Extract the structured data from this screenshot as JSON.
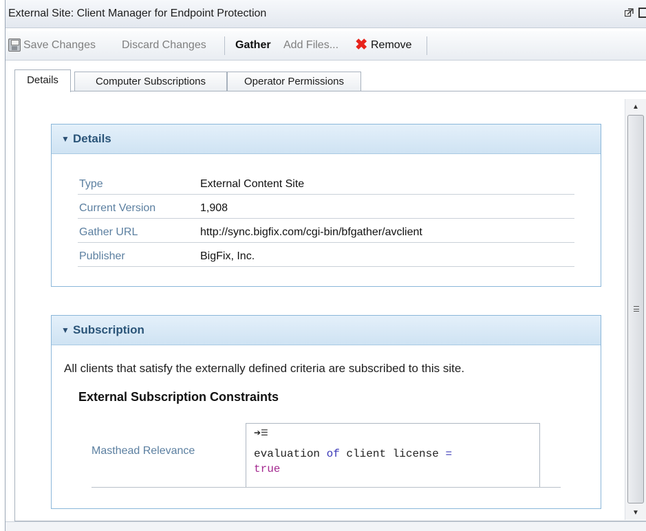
{
  "window": {
    "title": "External Site: Client Manager for Endpoint Protection"
  },
  "toolbar": {
    "save_label": "Save Changes",
    "discard_label": "Discard Changes",
    "gather_label": "Gather",
    "add_files_label": "Add Files...",
    "remove_label": "Remove"
  },
  "tabs": [
    {
      "label": "Details",
      "active": true
    },
    {
      "label": "Computer Subscriptions",
      "active": false
    },
    {
      "label": "Operator Permissions",
      "active": false
    }
  ],
  "details": {
    "header": "Details",
    "rows": [
      {
        "label": "Type",
        "value": "External Content Site"
      },
      {
        "label": "Current Version",
        "value": "1,908"
      },
      {
        "label": "Gather URL",
        "value": "http://sync.bigfix.com/cgi-bin/bfgather/avclient"
      },
      {
        "label": "Publisher",
        "value": "BigFix, Inc."
      }
    ]
  },
  "subscription": {
    "header": "Subscription",
    "text": "All clients that satisfy the externally defined criteria are subscribed to this site.",
    "constraints_heading": "External Subscription Constraints",
    "masthead_label": "Masthead Relevance",
    "relevance": {
      "part1": "evaluation ",
      "keyword": "of",
      "part2": " client license ",
      "operator": "=",
      "value": "true"
    }
  },
  "icons": {
    "save": "save-icon",
    "remove": "remove-icon",
    "restore": "restore-window-icon",
    "maximize": "maximize-icon",
    "caret": "caret-down-icon",
    "relevance_toggle": "relevance-format-icon"
  },
  "colors": {
    "panel_border": "#8ab6d9",
    "label_blue": "#5b7fa0",
    "remove_red": "#e8231b",
    "keyword_blue": "#3a38b8",
    "value_purple": "#a3288f"
  }
}
